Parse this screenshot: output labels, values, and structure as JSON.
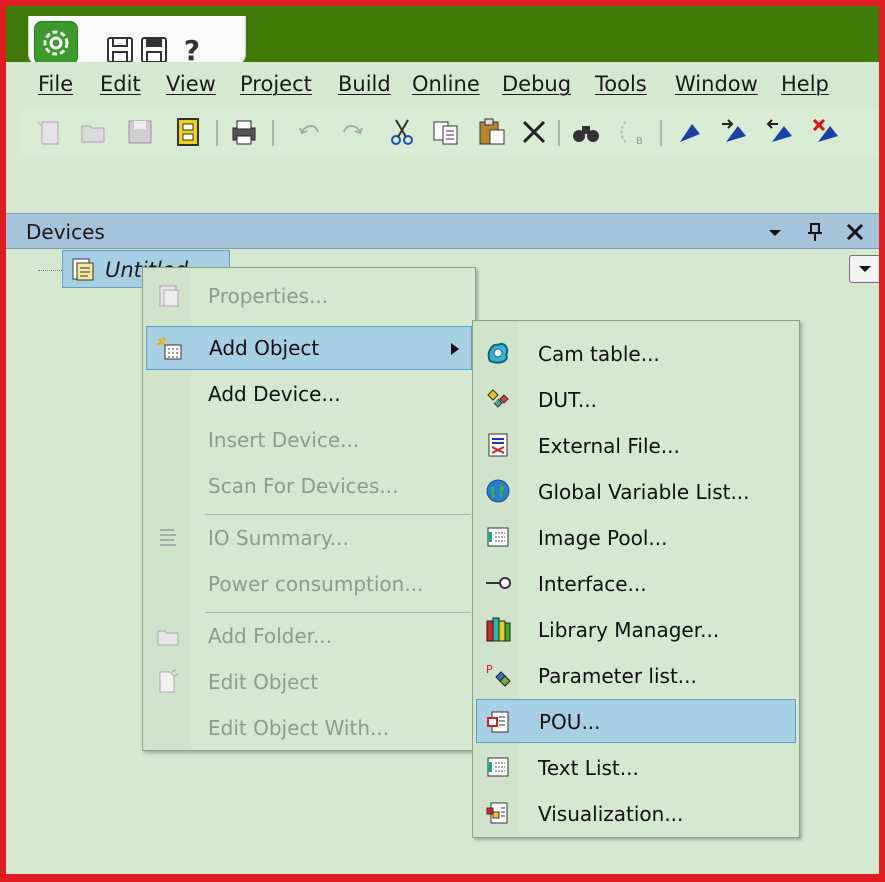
{
  "window": {
    "theme_accent": "#3f7a09",
    "highlight_border": "#e11b22"
  },
  "menubar": {
    "file": "File",
    "edit": "Edit",
    "view": "View",
    "project": "Project",
    "build": "Build",
    "online": "Online",
    "debug": "Debug",
    "tools": "Tools",
    "window": "Window",
    "help": "Help"
  },
  "devices_panel": {
    "title": "Devices"
  },
  "tree": {
    "root_label": "Untitled"
  },
  "context_menu": {
    "properties": "Properties...",
    "add_object": "Add Object",
    "add_device": "Add Device...",
    "insert_device": "Insert Device...",
    "scan_for_devices": "Scan For Devices...",
    "io_summary": "IO Summary...",
    "power_consumption": "Power consumption...",
    "add_folder": "Add Folder...",
    "edit_object": "Edit Object",
    "edit_object_with": "Edit Object With..."
  },
  "submenu": {
    "items": [
      "Cam table...",
      "DUT...",
      "External File...",
      "Global Variable List...",
      "Image Pool...",
      "Interface...",
      "Library Manager...",
      "Parameter list...",
      "POU...",
      "Text List...",
      "Visualization..."
    ],
    "highlighted": "POU..."
  }
}
